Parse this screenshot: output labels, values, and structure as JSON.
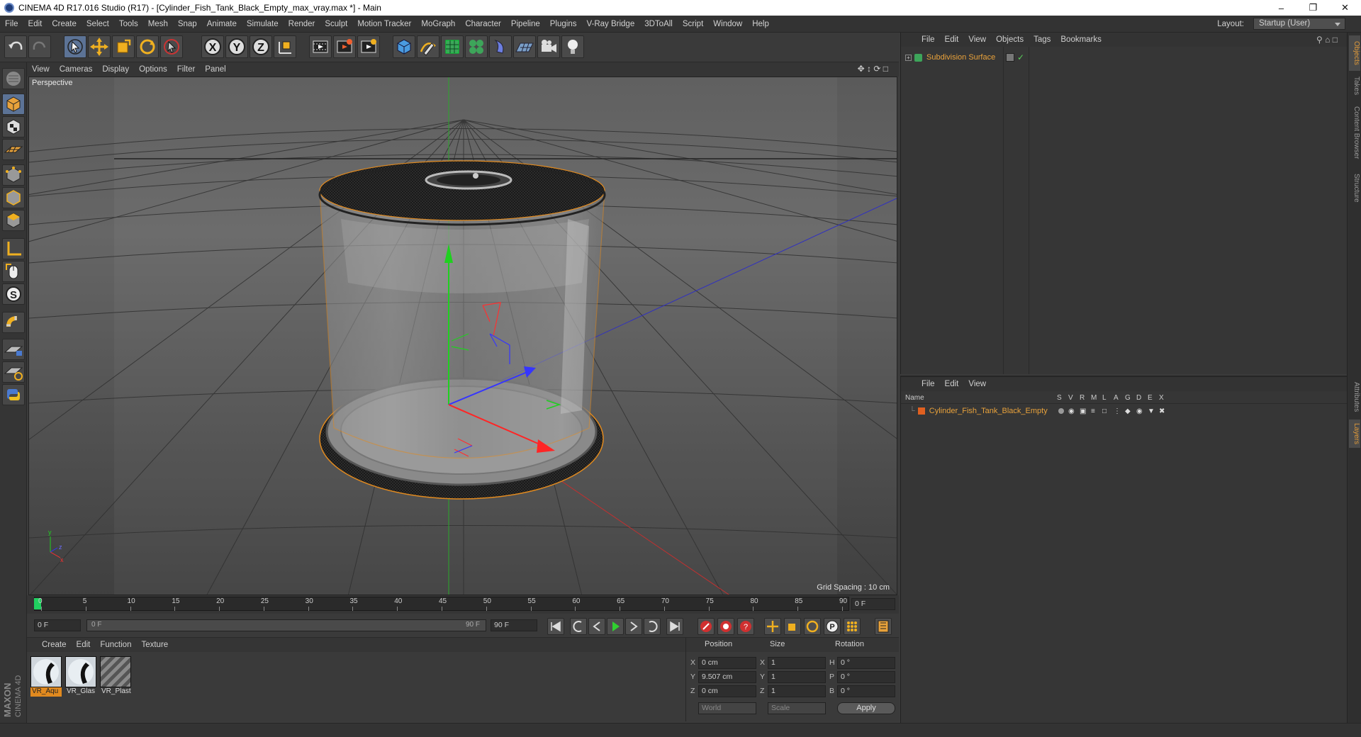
{
  "window": {
    "title": "CINEMA 4D R17.016 Studio (R17) - [Cylinder_Fish_Tank_Black_Empty_max_vray.max *] - Main"
  },
  "menu": [
    "File",
    "Edit",
    "Create",
    "Select",
    "Tools",
    "Mesh",
    "Snap",
    "Animate",
    "Simulate",
    "Render",
    "Sculpt",
    "Motion Tracker",
    "MoGraph",
    "Character",
    "Pipeline",
    "Plugins",
    "V-Ray Bridge",
    "3DToAll",
    "Script",
    "Window",
    "Help"
  ],
  "layout": {
    "label": "Layout:",
    "value": "Startup (User)"
  },
  "viewport": {
    "menu": [
      "View",
      "Cameras",
      "Display",
      "Options",
      "Filter",
      "Panel"
    ],
    "label": "Perspective",
    "grid_spacing": "Grid Spacing : 10 cm"
  },
  "timeline": {
    "ticks": [
      "0",
      "5",
      "10",
      "15",
      "20",
      "25",
      "30",
      "35",
      "40",
      "45",
      "50",
      "55",
      "60",
      "65",
      "70",
      "75",
      "80",
      "85",
      "90"
    ],
    "end_field": "0 F"
  },
  "transport": {
    "start": "0 F",
    "range_start": "0 F",
    "range_end": "90 F",
    "end": "90 F"
  },
  "materials": {
    "menu": [
      "Create",
      "Edit",
      "Function",
      "Texture"
    ],
    "items": [
      {
        "label": "VR_Aqu"
      },
      {
        "label": "VR_Glas"
      },
      {
        "label": "VR_Plast"
      }
    ]
  },
  "coords": {
    "headers": {
      "position": "Position",
      "size": "Size",
      "rotation": "Rotation"
    },
    "rows": [
      {
        "axis": "X",
        "pos": "0 cm",
        "saxis": "X",
        "size": "1",
        "raxis": "H",
        "rot": "0 °"
      },
      {
        "axis": "Y",
        "pos": "9.507 cm",
        "saxis": "Y",
        "size": "1",
        "raxis": "P",
        "rot": "0 °"
      },
      {
        "axis": "Z",
        "pos": "0 cm",
        "saxis": "Z",
        "size": "1",
        "raxis": "B",
        "rot": "0 °"
      }
    ],
    "mode": "World",
    "size_mode": "Scale",
    "apply": "Apply"
  },
  "objects": {
    "menu": [
      "File",
      "Edit",
      "View",
      "Objects",
      "Tags",
      "Bookmarks"
    ],
    "item": "Subdivision Surface"
  },
  "layers": {
    "menu": [
      "File",
      "Edit",
      "View"
    ],
    "columns": {
      "name": "Name",
      "flags": [
        "S",
        "V",
        "R",
        "M",
        "L",
        "A",
        "G",
        "D",
        "E",
        "X"
      ]
    },
    "item": "Cylinder_Fish_Tank_Black_Empty"
  },
  "right_tabs": [
    "Objects",
    "Takes",
    "Content Browser",
    "Structure",
    "Attributes",
    "Layers"
  ],
  "brand": {
    "maxon": "MAXON",
    "product": "CINEMA 4D"
  },
  "colors": {
    "accent": "#e18a1f",
    "selected_tool": "#5c7396",
    "active_label": "#e9a23b"
  }
}
